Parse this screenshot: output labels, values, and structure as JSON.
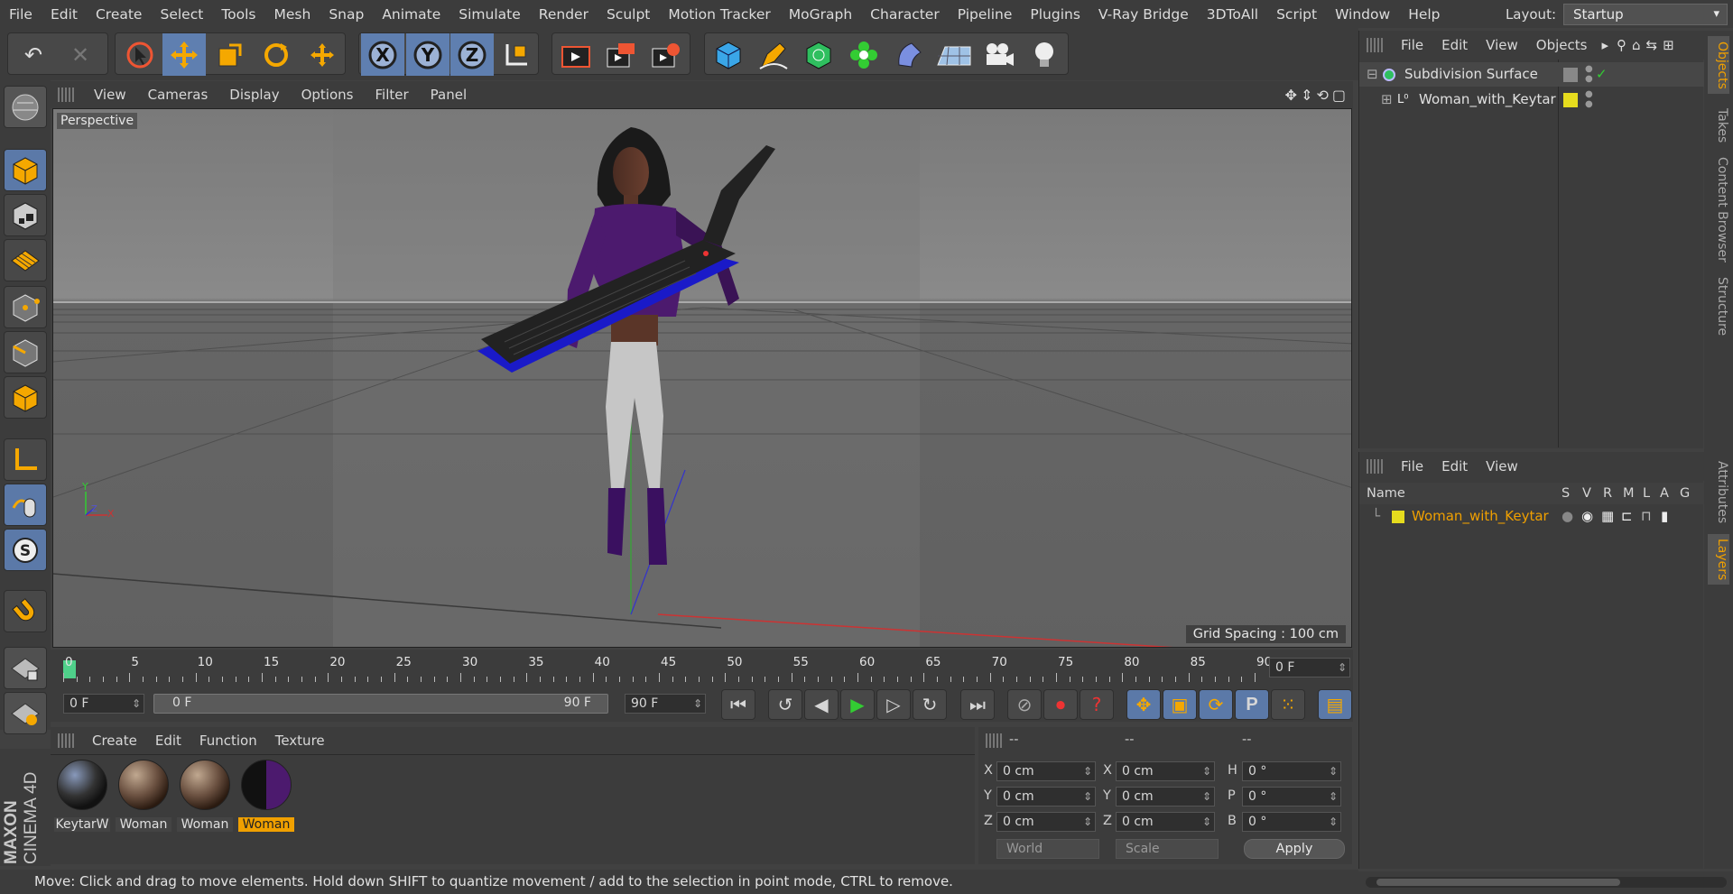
{
  "menubar": {
    "items": [
      "File",
      "Edit",
      "Create",
      "Select",
      "Tools",
      "Mesh",
      "Snap",
      "Animate",
      "Simulate",
      "Render",
      "Sculpt",
      "Motion Tracker",
      "MoGraph",
      "Character",
      "Pipeline",
      "Plugins",
      "V-Ray Bridge",
      "3DToAll",
      "Script",
      "Window",
      "Help"
    ],
    "layout_label": "Layout:",
    "layout_value": "Startup"
  },
  "viewport": {
    "menu": [
      "View",
      "Cameras",
      "Display",
      "Options",
      "Filter",
      "Panel"
    ],
    "label": "Perspective",
    "grid_spacing": "Grid Spacing : 100 cm",
    "axis_y": "Y",
    "axis_x": "X",
    "axis_z": "Z"
  },
  "timeline": {
    "ticks": [
      "0",
      "5",
      "10",
      "15",
      "20",
      "25",
      "30",
      "35",
      "40",
      "45",
      "50",
      "55",
      "60",
      "65",
      "70",
      "75",
      "80",
      "85",
      "90"
    ],
    "current_frame": "0 F",
    "start_field": "0 F",
    "range_start": "0 F",
    "range_end": "90 F",
    "end_field": "90 F"
  },
  "materials": {
    "menu": [
      "Create",
      "Edit",
      "Function",
      "Texture"
    ],
    "items": [
      {
        "name": "KeytarW",
        "selected": false
      },
      {
        "name": "Woman",
        "selected": false
      },
      {
        "name": "Woman",
        "selected": false
      },
      {
        "name": "Woman",
        "selected": true
      }
    ]
  },
  "coords": {
    "headers": [
      "--",
      "--",
      "--"
    ],
    "rows": [
      {
        "a": "X",
        "av": "0 cm",
        "b": "X",
        "bv": "0 cm",
        "c": "H",
        "cv": "0 °"
      },
      {
        "a": "Y",
        "av": "0 cm",
        "b": "Y",
        "bv": "0 cm",
        "c": "P",
        "cv": "0 °"
      },
      {
        "a": "Z",
        "av": "0 cm",
        "b": "Z",
        "bv": "0 cm",
        "c": "B",
        "cv": "0 °"
      }
    ],
    "world": "World",
    "scale": "Scale",
    "apply": "Apply"
  },
  "objects": {
    "menu": [
      "File",
      "Edit",
      "View",
      "Objects"
    ],
    "items": [
      {
        "name": "Subdivision Surface"
      },
      {
        "name": "Woman_with_Keytar"
      }
    ]
  },
  "layers": {
    "menu": [
      "File",
      "Edit",
      "View"
    ],
    "columns": [
      "Name",
      "S",
      "V",
      "R",
      "M",
      "L",
      "A",
      "G"
    ],
    "items": [
      {
        "name": "Woman_with_Keytar"
      }
    ]
  },
  "sidetabs": [
    "Objects",
    "Takes",
    "Content Browser",
    "Structure",
    "Attributes",
    "Layers"
  ],
  "status": "Move: Click and drag to move elements. Hold down SHIFT to quantize movement / add to the selection in point mode, CTRL to remove.",
  "brand": {
    "line1": "MAXON",
    "line2": "CINEMA 4D"
  },
  "colors": {
    "accent": "#f0a000",
    "active_tool": "#5f7fb0",
    "layer_color": "#e6dc1e",
    "keytar_blue": "#1a1ac8",
    "top_purple": "#4c1a6e"
  },
  "icons": [
    "undo-icon",
    "redo-icon",
    "select-icon",
    "move-icon",
    "scale-icon",
    "rotate-icon",
    "transform-icon",
    "x-axis-icon",
    "y-axis-icon",
    "z-axis-icon",
    "coordinate-system-icon",
    "render-view-icon",
    "render-picture-queue-icon",
    "render-settings-icon",
    "cube-icon",
    "pen-icon",
    "subdivide-icon",
    "cloner-icon",
    "deformer-icon",
    "floor-icon",
    "camera-icon",
    "light-icon"
  ]
}
